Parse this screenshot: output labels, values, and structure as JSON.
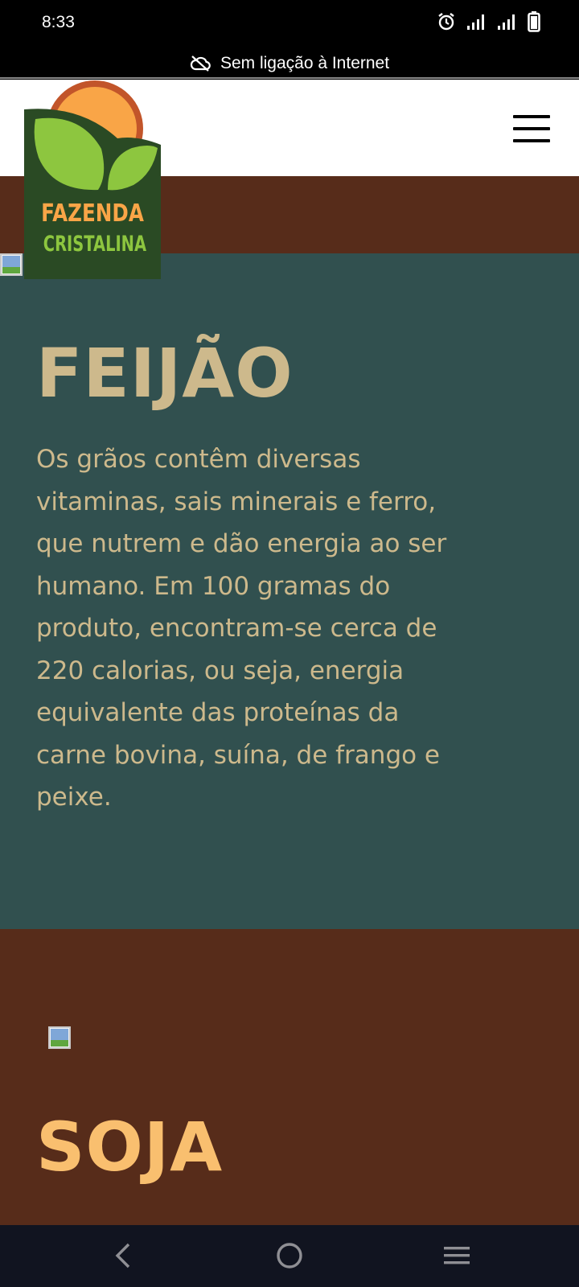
{
  "status_bar": {
    "time": "8:33",
    "icons": [
      "alarm-icon",
      "signal-icon",
      "signal-icon",
      "battery-icon"
    ]
  },
  "offline_banner": {
    "text": "Sem ligação à Internet",
    "icon": "cloud-off-icon"
  },
  "header": {
    "logo_line1": "FAZENDA",
    "logo_line2": "CRISTALINA",
    "menu_icon": "hamburger-menu-icon"
  },
  "sections": [
    {
      "title": "FEIJÃO",
      "body": "Os grãos contêm diversas vitaminas, sais minerais e ferro, que nutrem e dão energia ao ser humano. Em 100 gramas do produto, encontram-se cerca de 220 calorias, ou seja, energia equivalente das proteínas da carne bovina, suína, de frango e peixe."
    },
    {
      "title": "SOJA",
      "body": ""
    }
  ],
  "nav_bar": {
    "buttons": [
      "back-icon",
      "home-icon",
      "recents-icon"
    ]
  },
  "colors": {
    "brown": "#572c1a",
    "teal": "#31504f",
    "beige_text": "#cdb98c",
    "orange_text": "#f9bf6f",
    "logo_dark_green": "#2a4a24",
    "logo_leaf_green": "#8dc63f",
    "logo_sun_orange": "#f9a547",
    "logo_sun_rim": "#c2552a"
  }
}
